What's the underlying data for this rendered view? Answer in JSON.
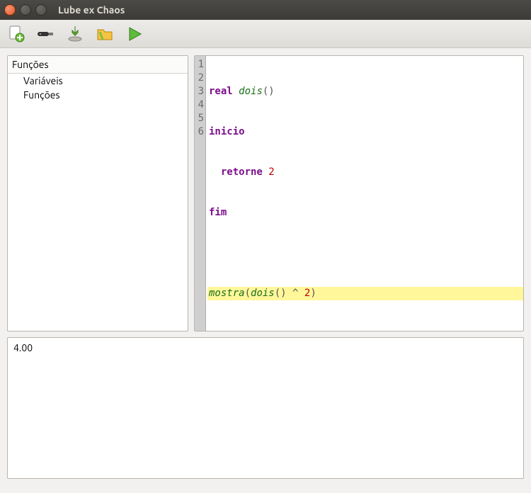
{
  "window": {
    "title": "Lube ex Chaos"
  },
  "toolbar": {
    "new": "new-file",
    "connect": "connect",
    "download": "download",
    "open": "open-folder",
    "run": "run"
  },
  "sidebar": {
    "header": "Funções",
    "items": [
      {
        "label": "Variáveis"
      },
      {
        "label": "Funções"
      }
    ]
  },
  "editor": {
    "lines": [
      "1",
      "2",
      "3",
      "4",
      "5",
      "6"
    ],
    "tokens": {
      "l1_kw": "real",
      "l1_fn": "dois",
      "l1_paren": "()",
      "l2_kw": "inicio",
      "l3_kw": "  retorne",
      "l3_num": "2",
      "l4_kw": "fim",
      "l6_fn1": "mostra",
      "l6_p1": "(",
      "l6_fn2": "dois",
      "l6_p2": "()",
      "l6_op": " ^ ",
      "l6_num": "2",
      "l6_p3": ")"
    }
  },
  "output": {
    "text": "4.00"
  }
}
